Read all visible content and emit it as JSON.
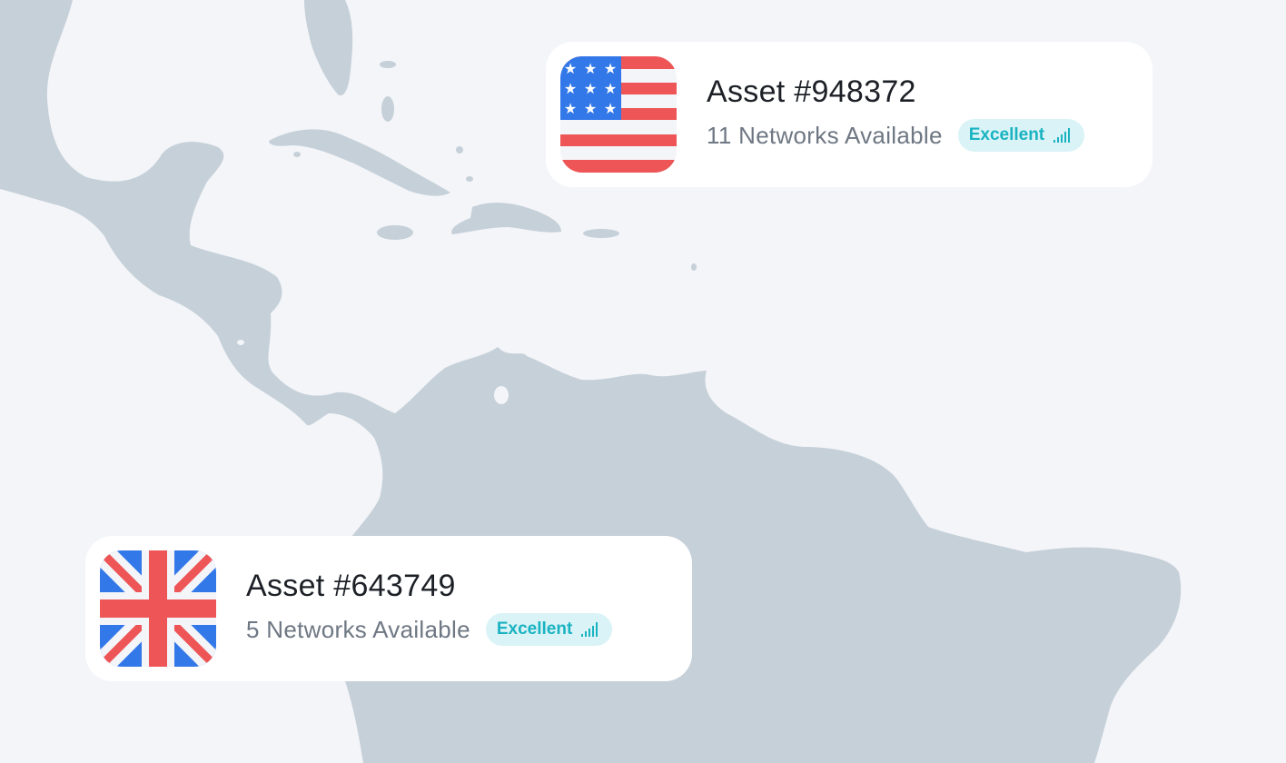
{
  "cards": [
    {
      "flag": "us-flag-icon",
      "title": "Asset #948372",
      "networks": "11 Networks Available",
      "badge": "Excellent",
      "badge_icon": "signal-bars-icon"
    },
    {
      "flag": "uk-flag-icon",
      "title": "Asset #643749",
      "networks": "5 Networks Available",
      "badge": "Excellent",
      "badge_icon": "signal-bars-icon"
    }
  ],
  "colors": {
    "background": "#f3f5f8",
    "land": "#c6d0d9",
    "card": "#ffffff",
    "badge_bg": "#d9f3f6",
    "badge_text": "#1ab3c2",
    "flag_red": "#ee5556",
    "flag_blue": "#3378e8"
  }
}
